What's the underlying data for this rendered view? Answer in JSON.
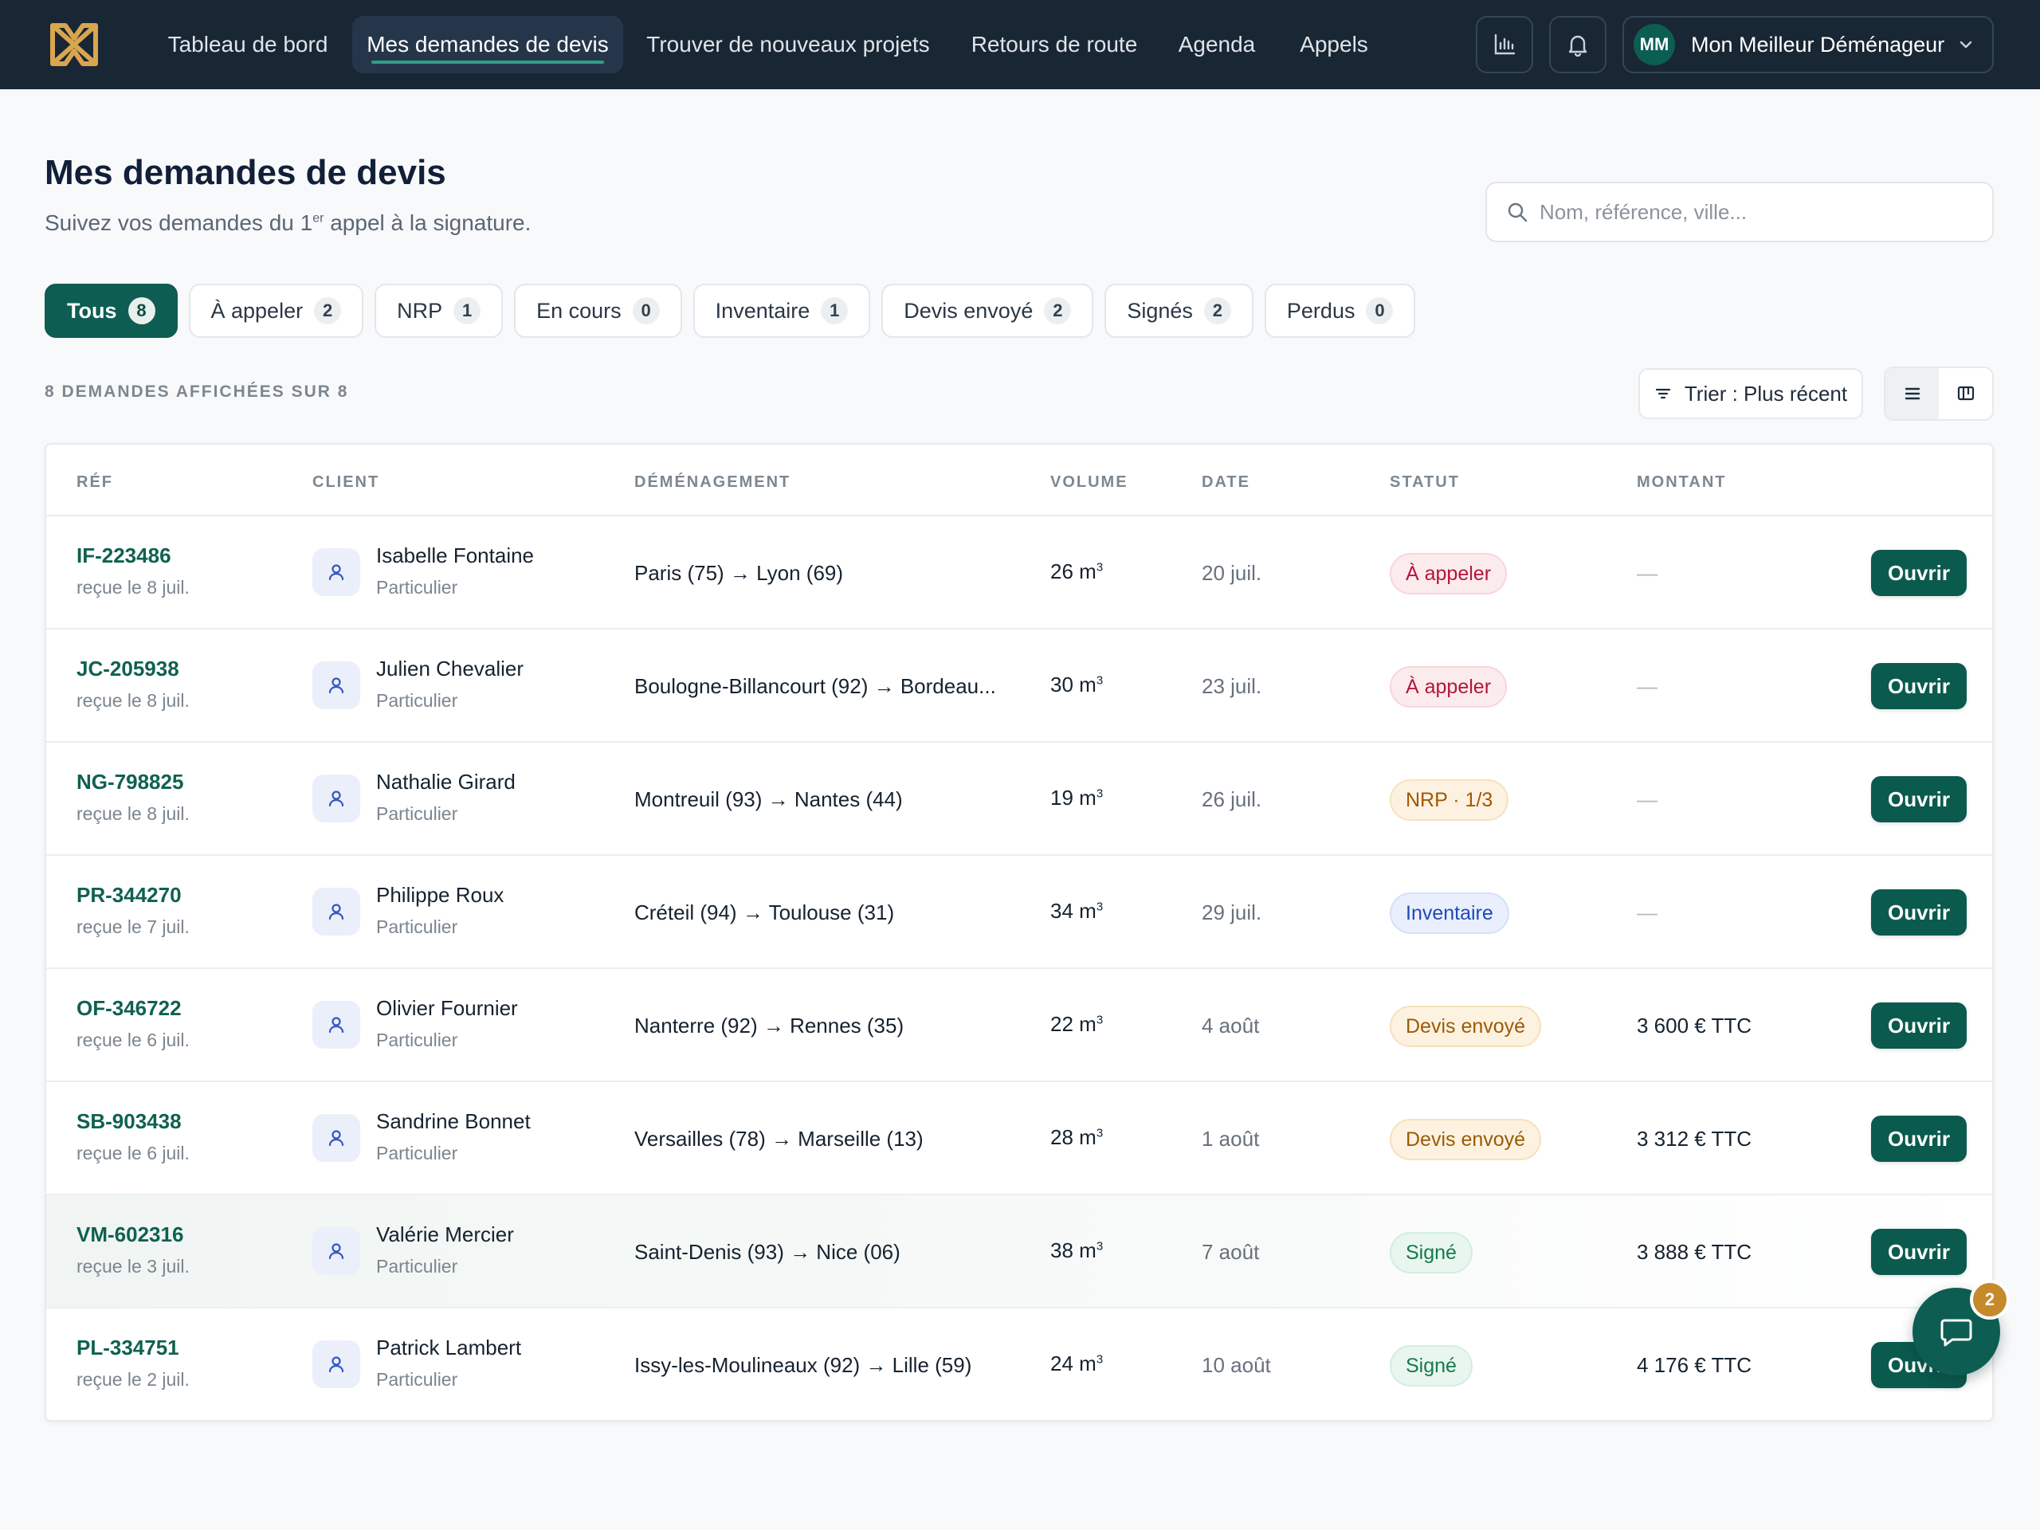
{
  "nav": {
    "items": [
      {
        "label": "Tableau de bord",
        "active": false
      },
      {
        "label": "Mes demandes de devis",
        "active": true
      },
      {
        "label": "Trouver de nouveaux projets",
        "active": false
      },
      {
        "label": "Retours de route",
        "active": false
      },
      {
        "label": "Agenda",
        "active": false
      },
      {
        "label": "Appels",
        "active": false
      }
    ],
    "account": {
      "initials": "MM",
      "name": "Mon Meilleur Déménageur"
    }
  },
  "header": {
    "title": "Mes demandes de devis",
    "subtitle_before": "Suivez vos demandes du 1",
    "subtitle_sup": "er",
    "subtitle_after": " appel à la signature.",
    "search_placeholder": "Nom, référence, ville..."
  },
  "filters": [
    {
      "label": "Tous",
      "count": "8",
      "active": true
    },
    {
      "label": "À appeler",
      "count": "2",
      "active": false
    },
    {
      "label": "NRP",
      "count": "1",
      "active": false
    },
    {
      "label": "En cours",
      "count": "0",
      "active": false
    },
    {
      "label": "Inventaire",
      "count": "1",
      "active": false
    },
    {
      "label": "Devis envoyé",
      "count": "2",
      "active": false
    },
    {
      "label": "Signés",
      "count": "2",
      "active": false
    },
    {
      "label": "Perdus",
      "count": "0",
      "active": false
    }
  ],
  "toolbar": {
    "shown_count": "8 DEMANDES AFFICHÉES SUR 8",
    "sort_label": "Trier : Plus récent"
  },
  "table": {
    "columns": [
      "RÉF",
      "CLIENT",
      "DÉMÉNAGEMENT",
      "VOLUME",
      "DATE",
      "STATUT",
      "MONTANT"
    ],
    "open_label": "Ouvrir",
    "volume_unit_sup": "3",
    "rows": [
      {
        "ref": "IF-223486",
        "received": "reçue le 8 juil.",
        "client": "Isabelle Fontaine",
        "type": "Particulier",
        "route": "Paris (75) → Lyon (69)",
        "volume": "26 m",
        "date": "20 juil.",
        "status": "À appeler",
        "status_kind": "call",
        "amount": "—"
      },
      {
        "ref": "JC-205938",
        "received": "reçue le 8 juil.",
        "client": "Julien Chevalier",
        "type": "Particulier",
        "route": "Boulogne-Billancourt (92) → Bordeau...",
        "volume": "30 m",
        "date": "23 juil.",
        "status": "À appeler",
        "status_kind": "call",
        "amount": "—"
      },
      {
        "ref": "NG-798825",
        "received": "reçue le 8 juil.",
        "client": "Nathalie Girard",
        "type": "Particulier",
        "route": "Montreuil (93) → Nantes (44)",
        "volume": "19 m",
        "date": "26 juil.",
        "status": "NRP · 1/3",
        "status_kind": "nrp",
        "amount": "—"
      },
      {
        "ref": "PR-344270",
        "received": "reçue le 7 juil.",
        "client": "Philippe Roux",
        "type": "Particulier",
        "route": "Créteil (94) → Toulouse (31)",
        "volume": "34 m",
        "date": "29 juil.",
        "status": "Inventaire",
        "status_kind": "inv",
        "amount": "—"
      },
      {
        "ref": "OF-346722",
        "received": "reçue le 6 juil.",
        "client": "Olivier Fournier",
        "type": "Particulier",
        "route": "Nanterre (92) → Rennes (35)",
        "volume": "22 m",
        "date": "4 août",
        "status": "Devis envoyé",
        "status_kind": "sent",
        "amount": "3 600 € TTC"
      },
      {
        "ref": "SB-903438",
        "received": "reçue le 6 juil.",
        "client": "Sandrine Bonnet",
        "type": "Particulier",
        "route": "Versailles (78) → Marseille (13)",
        "volume": "28 m",
        "date": "1 août",
        "status": "Devis envoyé",
        "status_kind": "sent",
        "amount": "3 312 € TTC"
      },
      {
        "ref": "VM-602316",
        "received": "reçue le 3 juil.",
        "client": "Valérie Mercier",
        "type": "Particulier",
        "route": "Saint-Denis (93) → Nice (06)",
        "volume": "38 m",
        "date": "7 août",
        "status": "Signé",
        "status_kind": "signed",
        "amount": "3 888 € TTC"
      },
      {
        "ref": "PL-334751",
        "received": "reçue le 2 juil.",
        "client": "Patrick Lambert",
        "type": "Particulier",
        "route": "Issy-les-Moulineaux (92) → Lille (59)",
        "volume": "24 m",
        "date": "10 août",
        "status": "Signé",
        "status_kind": "signed",
        "amount": "4 176 € TTC"
      }
    ]
  },
  "chat": {
    "badge": "2"
  },
  "colors": {
    "nav_bg": "#192634",
    "accent": "#0e5d52",
    "ref_green": "#0f6150",
    "logo_gold": "#d9a64e"
  }
}
